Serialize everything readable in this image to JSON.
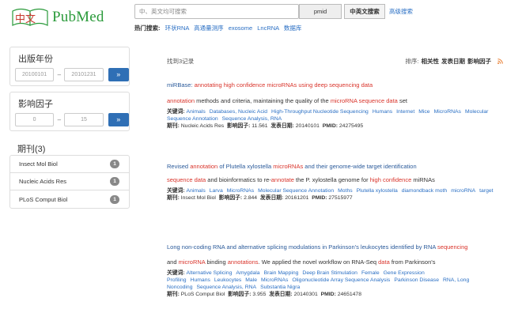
{
  "logo": {
    "chinese_glyphs": "中文",
    "pubmed": "PubMed"
  },
  "search": {
    "placeholder": "中、英文均可搜索",
    "pmid_label": "pmid",
    "cn_en_label": "中英文搜索",
    "advanced_label": "高级搜索"
  },
  "hot": {
    "label": "热门搜索:",
    "items": [
      "环状RNA",
      "高通量测序",
      "exosome",
      "LncRNA",
      "数据库"
    ]
  },
  "filters": {
    "date": {
      "title": "出版年份",
      "from": "20100101",
      "to": "20101231",
      "go": "»"
    },
    "impact": {
      "title": "影响因子",
      "from": "0",
      "to": "15",
      "go": "»"
    },
    "journal": {
      "title": "期刊",
      "count": "(3)",
      "items": [
        {
          "name": "Insect Mol Biol",
          "count": "1"
        },
        {
          "name": "Nucleic Acids Res",
          "count": "1"
        },
        {
          "name": "PLoS Comput Biol",
          "count": "1"
        }
      ]
    }
  },
  "results_header": {
    "found": "找到3记录",
    "sort_label": "排序:",
    "sort_relevance": "相关性",
    "sort_date": "发表日期",
    "sort_impact": "影响因子"
  },
  "results": [
    {
      "title_prefix": "miRBase: ",
      "title_h1": "annotating high confidence microRNAs using deep sequencing data",
      "snippet_h1": "annotation",
      "snippet_mid": " methods and criteria, maintaining the quality of the ",
      "snippet_h2": "microRNA sequence data",
      "snippet_end": " set",
      "keywords_label": "关键词:",
      "keywords": [
        "Animals",
        "Databases, Nucleic Acid",
        "High-Throughput Nucleotide Sequencing",
        "Humans",
        "Internet",
        "Mice",
        "MicroRNAs",
        "Molecular Sequence Annotation",
        "Sequence Analysis, RNA"
      ],
      "journal_label": "期刊:",
      "journal": "Nucleic Acids Res",
      "if_label": "影响因子:",
      "if": "11.561",
      "date_label": "发表日期:",
      "date": "20140101",
      "pmid_label": "PMID:",
      "pmid": "24275495"
    },
    {
      "title_a": "Revised ",
      "title_h1": "annotation",
      "title_b": " of Plutella xylostella ",
      "title_h2": "microRNAs",
      "title_c": " and their genome-wide target identification",
      "snippet_h1": "sequence data",
      "snippet_a": " and bioinformatics to re-",
      "snippet_h2": "annotate",
      "snippet_b": " the P. xylostella genome for ",
      "snippet_h3": "high confidence",
      "snippet_c": " miRNAs",
      "keywords_label": "关键词:",
      "keywords": [
        "Animals",
        "Larva",
        "MicroRNAs",
        "Molecular Sequence Annotation",
        "Moths",
        "Plutella xylostella",
        "diamondback moth",
        "microRNA",
        "target"
      ],
      "journal_label": "期刊:",
      "journal": "Insect Mol Biol",
      "if_label": "影响因子:",
      "if": "2.844",
      "date_label": "发表日期:",
      "date": "20161201",
      "pmid_label": "PMID:",
      "pmid": "27515977"
    },
    {
      "title_a": "Long non-coding RNA and alternative splicing modulations in Parkinson's leukocytes identified by RNA ",
      "title_h1": "sequencing",
      "snippet_a": "and ",
      "snippet_h1": "microRNA",
      "snippet_b": " binding ",
      "snippet_h2": "annotations",
      "snippet_c": ". We applied the novel workflow on RNA-Seq ",
      "snippet_h3": "data",
      "snippet_d": " from Parkinson's",
      "keywords_label": "关键词:",
      "keywords": [
        "Alternative Splicing",
        "Amygdala",
        "Brain Mapping",
        "Deep Brain Stimulation",
        "Female",
        "Gene Expression Profiling",
        "Humans",
        "Leukocytes",
        "Male",
        "MicroRNAs",
        "Oligonucleotide Array Sequence Analysis",
        "Parkinson Disease",
        "RNA, Long Noncoding",
        "Sequence Analysis, RNA",
        "Substantia Nigra"
      ],
      "journal_label": "期刊:",
      "journal": "PLoS Comput Biol",
      "if_label": "影响因子:",
      "if": "3.955",
      "date_label": "发表日期:",
      "date": "20140301",
      "pmid_label": "PMID:",
      "pmid": "24651478"
    }
  ],
  "colors": {
    "accent": "#2f6fb5",
    "highlight": "#d9342b",
    "link": "#2a6fc4",
    "logo_green": "#2a9a3a",
    "logo_red": "#c8372d"
  }
}
